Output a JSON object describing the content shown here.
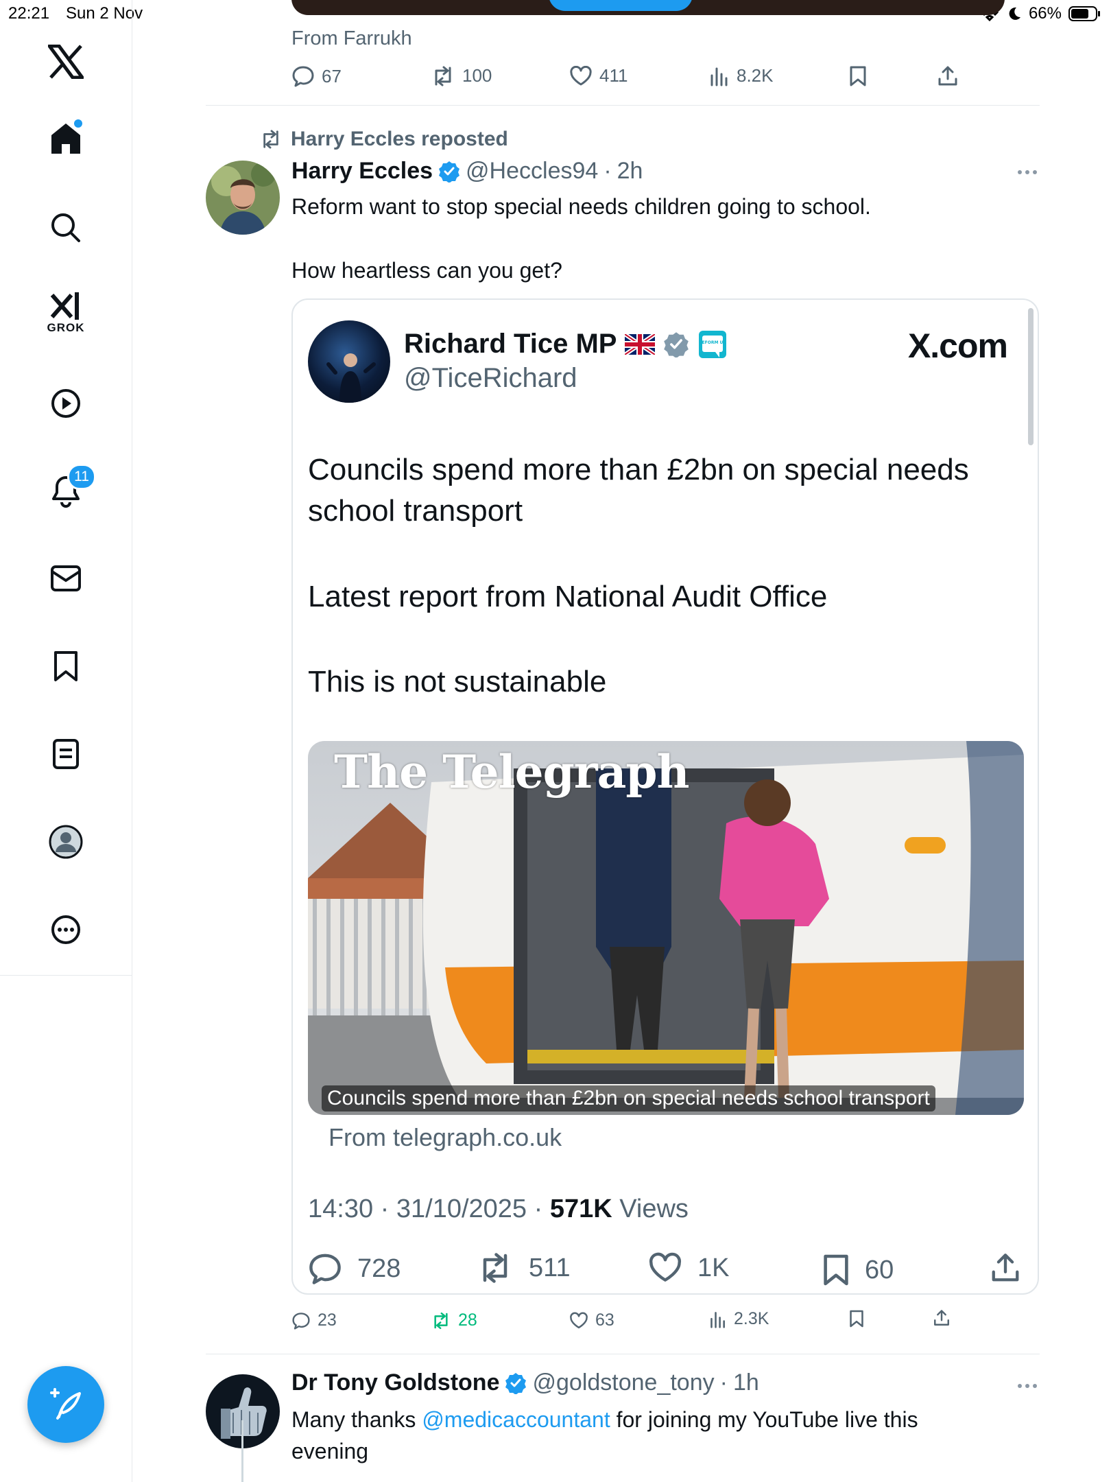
{
  "status_bar": {
    "time": "22:21",
    "date": "Sun 2 Nov",
    "battery": "66%"
  },
  "sidebar": {
    "items": [
      {
        "id": "logo",
        "icon": "x-logo-icon"
      },
      {
        "id": "home",
        "icon": "home-icon",
        "has_dot": true
      },
      {
        "id": "search",
        "icon": "search-icon"
      },
      {
        "id": "grok",
        "icon": "grok-icon",
        "label": "GROK"
      },
      {
        "id": "video",
        "icon": "play-icon"
      },
      {
        "id": "notifications",
        "icon": "bell-icon",
        "badge": "11"
      },
      {
        "id": "messages",
        "icon": "mail-icon"
      },
      {
        "id": "bookmarks",
        "icon": "bookmark-icon"
      },
      {
        "id": "lists",
        "icon": "lists-icon"
      },
      {
        "id": "profile",
        "icon": "profile-icon"
      },
      {
        "id": "more",
        "icon": "more-circle-icon"
      }
    ],
    "compose_icon": "compose-icon"
  },
  "prev_tweet": {
    "from_label": "From Farrukh",
    "replies": "67",
    "reposts": "100",
    "likes": "411",
    "views": "8.2K"
  },
  "tweet": {
    "repost_label": "Harry Eccles reposted",
    "author_name": "Harry Eccles",
    "handle": "@Heccles94",
    "time": "2h",
    "text_line_1": "Reform want to stop special needs children going to school.",
    "text_line_2": "How heartless can you get?",
    "replies": "23",
    "reposts": "28",
    "likes": "63",
    "views": "2.3K",
    "repost_active_color": "#00ba7c"
  },
  "embedded": {
    "name": "Richard Tice MP",
    "handle": "@TiceRichard",
    "source": "X.com",
    "party_badge": "REFORM UK",
    "para_1": "Councils spend more than £2bn on special needs school transport",
    "para_2": "Latest report from National Audit Office",
    "para_3": "This is not sustainable",
    "image_logo": "The Telegraph",
    "image_caption": "Councils spend more than £2bn on special needs school transport",
    "from_site": "From telegraph.co.uk",
    "timestamp": "14:30 · 31/10/2025 · ",
    "views_count": "571K",
    "views_label": "Views",
    "replies": "728",
    "reposts": "511",
    "likes": "1K",
    "bookmarks": "60"
  },
  "next_tweet": {
    "author_name": "Dr Tony Goldstone",
    "handle": "@goldstone_tony",
    "time": "1h",
    "text_before": "Many thanks ",
    "mention": "@medicaccountant",
    "text_after": " for joining my YouTube live this",
    "text_line_2": "evening"
  },
  "colors": {
    "accent": "#1d9bf0",
    "muted": "#536471",
    "text": "#0f1419",
    "repost_green": "#00ba7c"
  }
}
